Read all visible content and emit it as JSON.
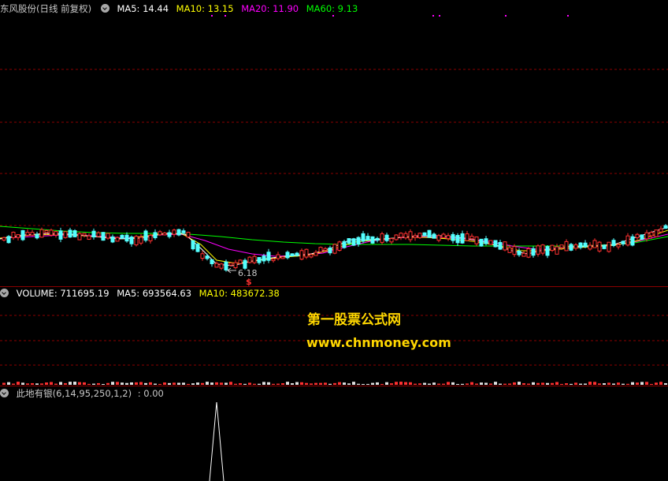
{
  "main_panel": {
    "title": "东风股份(日线 前复权)",
    "ma5": "MA5: 14.44",
    "ma10": "MA10: 13.15",
    "ma20": "MA20: 11.90",
    "ma60": "MA60: 9.13",
    "low_label": "6.18",
    "signal_mark": "$",
    "colors": {
      "ma5": "#ffffff",
      "ma10": "#ffff00",
      "ma20": "#ff00ff",
      "ma60": "#00ff00"
    }
  },
  "volume_panel": {
    "title": "VOLUME: 711695.19",
    "ma5": "MA5: 693564.63",
    "ma10": "MA10: 483672.38"
  },
  "indicator_panel": {
    "title": "此地有银(6,14,95,250,1,2)",
    "value": ": 0.00"
  },
  "watermark": {
    "line1": "第一股票公式网",
    "line2": "www.chnmoney.com"
  },
  "colors": {
    "grid": "#8b0000",
    "up": "#ff3030",
    "down": "#54ffff",
    "watermark": "#ffd700"
  }
}
